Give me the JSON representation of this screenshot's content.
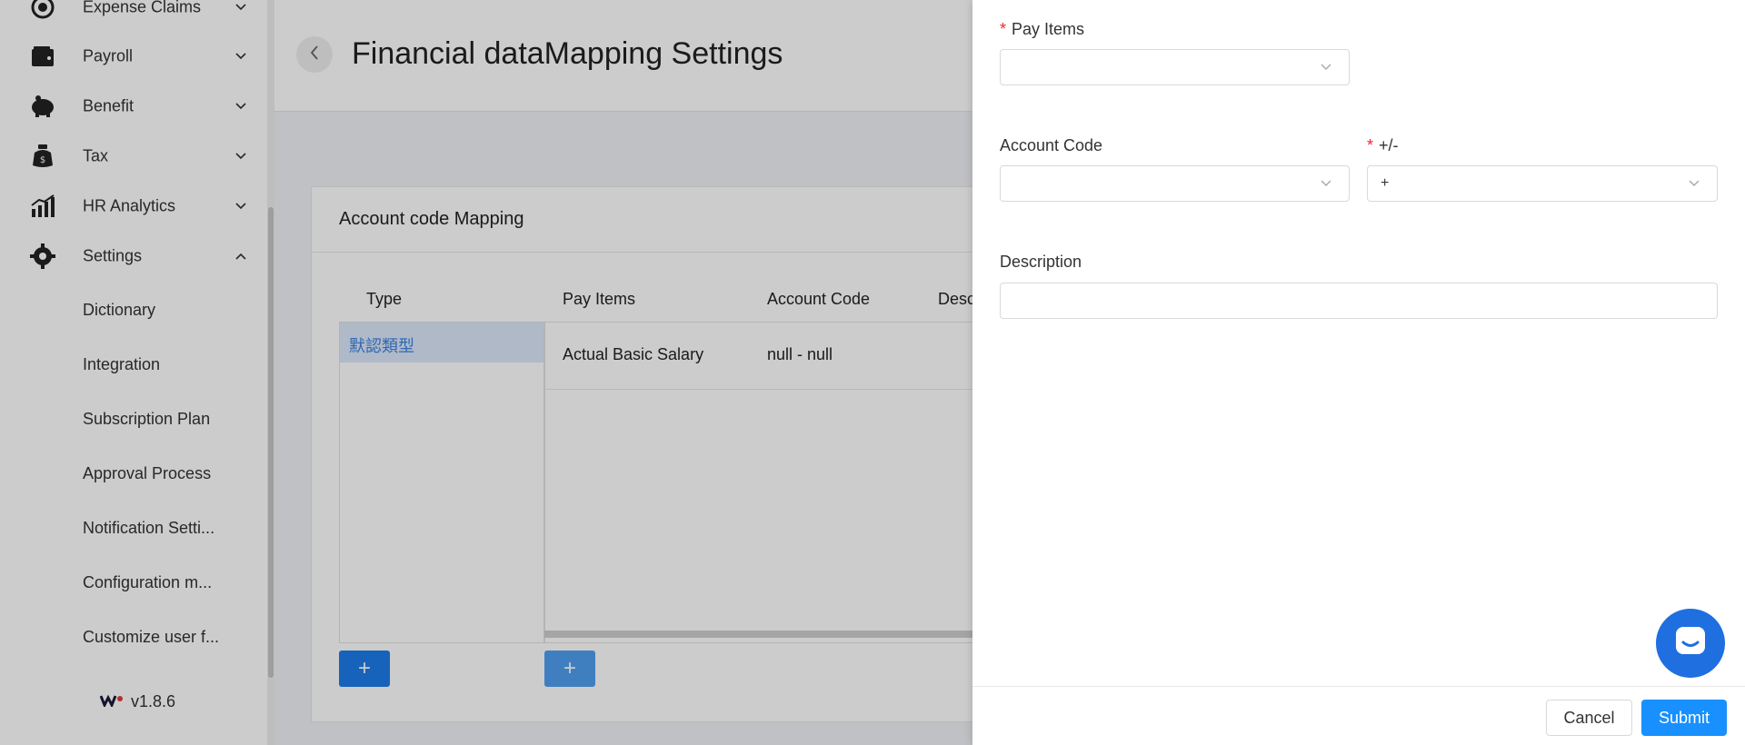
{
  "sidebar": {
    "items": [
      {
        "label": "Expense Claims",
        "icon": "expense-icon",
        "expanded": false
      },
      {
        "label": "Payroll",
        "icon": "wallet-icon",
        "expanded": false
      },
      {
        "label": "Benefit",
        "icon": "piggy-bank-icon",
        "expanded": false
      },
      {
        "label": "Tax",
        "icon": "money-bag-icon",
        "expanded": false
      },
      {
        "label": "HR Analytics",
        "icon": "bar-chart-icon",
        "expanded": false
      },
      {
        "label": "Settings",
        "icon": "gear-icon",
        "expanded": true
      }
    ],
    "sub_items": [
      "Dictionary",
      "Integration",
      "Subscription Plan",
      "Approval Process",
      "Notification Setti...",
      "Configuration m...",
      "Customize user f..."
    ],
    "version": "v1.8.6"
  },
  "header": {
    "title": "Financial dataMapping Settings"
  },
  "card": {
    "title": "Account code Mapping",
    "type_column": "Type",
    "type_rows": [
      "默認類型"
    ],
    "columns": [
      "Pay Items",
      "Account Code",
      "Desc"
    ],
    "rows": [
      {
        "pay_item": "Actual Basic Salary",
        "account_code": "null - null"
      }
    ],
    "add_label": "+"
  },
  "drawer": {
    "pay_items": {
      "label": "Pay Items",
      "value": "",
      "required": true
    },
    "account_code": {
      "label": "Account Code",
      "value": "",
      "required": false
    },
    "sign": {
      "label": "+/-",
      "value": "+",
      "required": true
    },
    "description": {
      "label": "Description",
      "value": ""
    },
    "cancel_label": "Cancel",
    "submit_label": "Submit"
  },
  "colors": {
    "primary": "#1890ff",
    "required": "#f5222d",
    "selected_row_bg": "#dbe8fa",
    "chat_fab": "#1f6fe0"
  }
}
